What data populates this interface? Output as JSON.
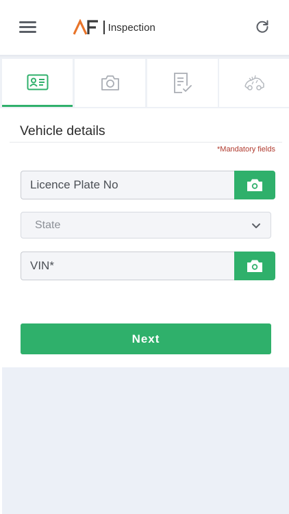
{
  "header": {
    "logo_text": "Inspection",
    "menu_icon": "hamburger-menu-icon",
    "refresh_icon": "refresh-icon"
  },
  "tabs": [
    {
      "icon": "id-card-icon",
      "active": true
    },
    {
      "icon": "camera-icon",
      "active": false
    },
    {
      "icon": "checklist-icon",
      "active": false
    },
    {
      "icon": "damage-icon",
      "active": false
    }
  ],
  "form": {
    "section_title": "Vehicle details",
    "mandatory_note": "*Mandatory fields",
    "plate_placeholder": "Licence Plate No",
    "state_placeholder": "State",
    "vin_placeholder": "VIN*",
    "next_label": "Next"
  },
  "colors": {
    "accent": "#2fb06b",
    "logo_orange": "#e8742a",
    "logo_dark": "#3a3a3a",
    "mandatory_red": "#b03a2e",
    "footer_bg": "#ecf0f7"
  }
}
